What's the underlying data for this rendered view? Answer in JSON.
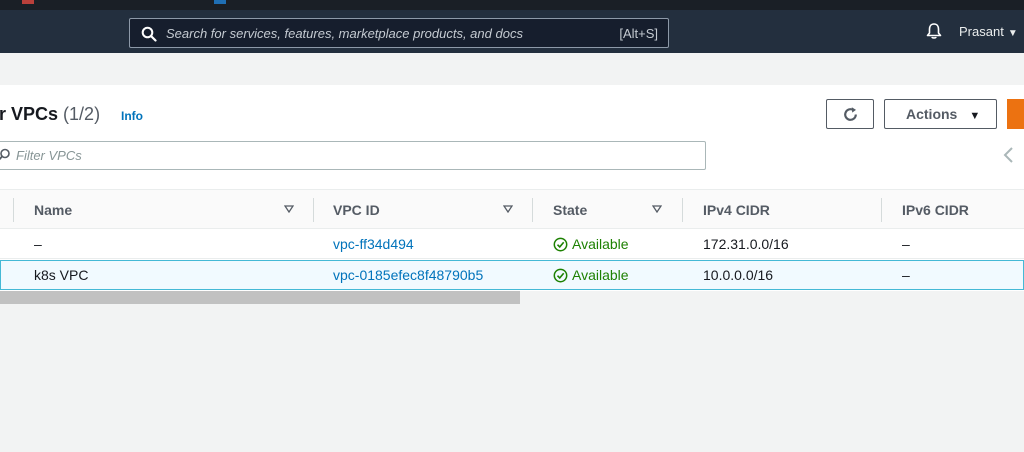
{
  "header": {
    "search_placeholder": "Search for services, features, marketplace products, and docs",
    "search_shortcut": "[Alt+S]",
    "user_name": "Prasant",
    "user_caret": "▼"
  },
  "vpc_panel": {
    "title": "ur VPCs",
    "count": "(1/2)",
    "info_link": "Info",
    "actions_label": "Actions",
    "actions_caret": "▼",
    "filter_placeholder": "Filter VPCs"
  },
  "table": {
    "columns": [
      "Name",
      "VPC ID",
      "State",
      "IPv4 CIDR",
      "IPv6 CIDR"
    ],
    "rows": [
      {
        "name": "–",
        "vpc_id": "vpc-ff34d494",
        "state": "Available",
        "ipv4": "172.31.0.0/16",
        "ipv6": "–",
        "selected": false
      },
      {
        "name": "k8s VPC",
        "vpc_id": "vpc-0185efec8f48790b5",
        "state": "Available",
        "ipv4": "10.0.0.0/16",
        "ipv6": "–",
        "selected": true
      }
    ]
  },
  "colors": {
    "nav_bg": "#232f3e",
    "link": "#0073bb",
    "status_ok": "#1d8102",
    "primary_button": "#ec7211",
    "selected_row_bg": "#f1faff",
    "selected_row_border": "#44b9d6"
  },
  "icons": {
    "search": "search-icon",
    "bell": "bell-icon",
    "refresh": "refresh-icon",
    "sort": "sort-down-icon",
    "status": "check-circle-icon",
    "prev_page": "chevron-left-icon"
  }
}
